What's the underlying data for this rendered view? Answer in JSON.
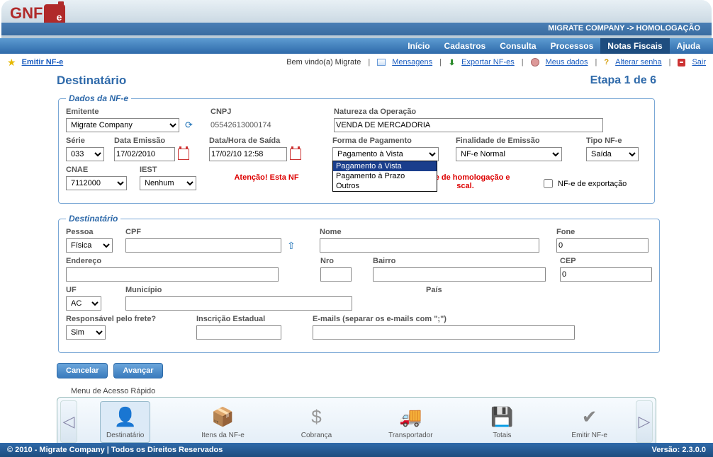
{
  "header": {
    "company_path": "MIGRATE COMPANY -> HOMOLOGAÇÃO"
  },
  "menu": {
    "items": [
      "Início",
      "Cadastros",
      "Consulta",
      "Processos",
      "Notas Fiscais",
      "Ajuda"
    ],
    "active_index": 4
  },
  "linkbar": {
    "emit": "Emitir NF-e",
    "welcome": "Bem vindo(a) Migrate",
    "mensagens": "Mensagens",
    "exportar": "Exportar NF-es",
    "meus_dados": "Meus dados",
    "alterar_senha": "Alterar senha",
    "sair": "Sair"
  },
  "page": {
    "title": "Destinatário",
    "step": "Etapa 1 de 6"
  },
  "dados_nfe": {
    "legend": "Dados da NF-e",
    "emitente_label": "Emitente",
    "emitente_value": "Migrate Company",
    "cnpj_label": "CNPJ",
    "cnpj_value": "05542613000174",
    "natureza_label": "Natureza da Operação",
    "natureza_value": "VENDA DE MERCADORIA",
    "serie_label": "Série",
    "serie_value": "033",
    "data_emissao_label": "Data Emissão",
    "data_emissao_value": "17/02/2010",
    "data_saida_label": "Data/Hora de Saída",
    "data_saida_value": "17/02/10 12:58",
    "forma_pag_label": "Forma de Pagamento",
    "forma_pag_value": "Pagamento à Vista",
    "forma_pag_options": [
      "Pagamento à Vista",
      "Pagamento à Prazo",
      "Outros"
    ],
    "finalidade_label": "Finalidade de Emissão",
    "finalidade_value": "NF-e Normal",
    "tipo_label": "Tipo NF-e",
    "tipo_value": "Saída",
    "cnae_label": "CNAE",
    "cnae_value": "7112000",
    "iest_label": "IEST",
    "iest_value": "Nenhum",
    "warn_pre": "Atenção! Esta NF",
    "warn_post": "mbiente de homologação e",
    "warn_line2": "scal.",
    "export_checkbox": "NF-e de exportação"
  },
  "destinatario": {
    "legend": "Destinatário",
    "pessoa_label": "Pessoa",
    "pessoa_value": "Física",
    "cpf_label": "CPF",
    "cpf_value": "",
    "nome_label": "Nome",
    "nome_value": "",
    "fone_label": "Fone",
    "fone_value": "0",
    "endereco_label": "Endereço",
    "endereco_value": "",
    "nro_label": "Nro",
    "nro_value": "",
    "bairro_label": "Bairro",
    "bairro_value": "",
    "cep_label": "CEP",
    "cep_value": "0",
    "uf_label": "UF",
    "uf_value": "AC",
    "municipio_label": "Município",
    "municipio_value": "",
    "pais_label": "País",
    "frete_label": "Responsável pelo frete?",
    "frete_value": "Sim",
    "insc_label": "Inscrição Estadual",
    "insc_value": "",
    "emails_label": "E-mails  (separar os e-mails com \";\")",
    "emails_value": ""
  },
  "buttons": {
    "cancel": "Cancelar",
    "next": "Avançar"
  },
  "quickmenu": {
    "title": "Menu de Acesso Rápido",
    "items": [
      "Destinatário",
      "Itens da NF-e",
      "Cobrança",
      "Transportador",
      "Totais",
      "Emitir NF-e"
    ]
  },
  "footer": {
    "copyright": "© 2010 - Migrate Company | Todos os Direitos Reservados",
    "version": "Versão: 2.3.0.0"
  }
}
